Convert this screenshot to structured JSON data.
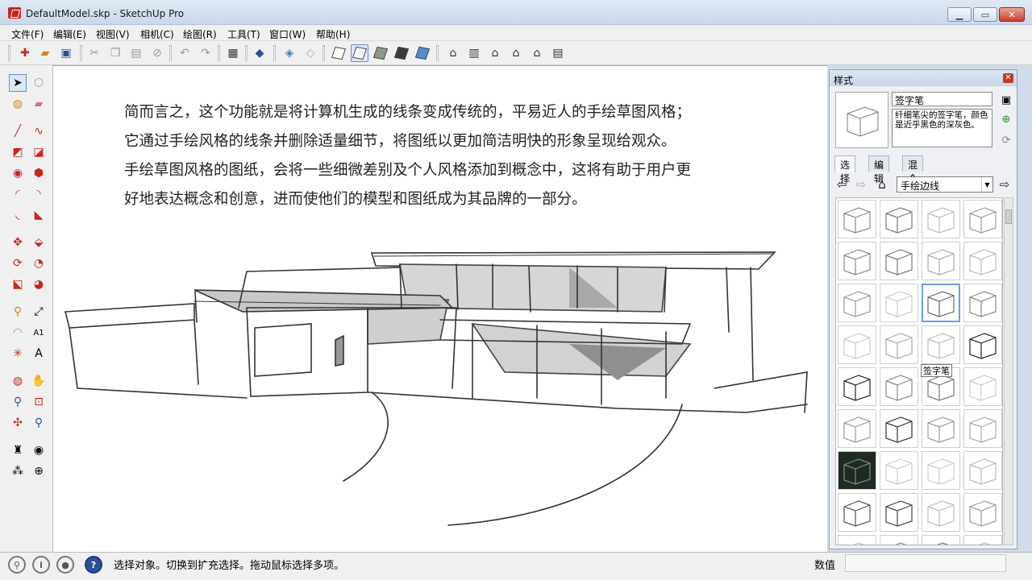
{
  "window": {
    "title": "DefaultModel.skp - SketchUp Pro",
    "minimize": "▁",
    "maximize": "▭",
    "close": "✕"
  },
  "menu": [
    "文件(F)",
    "编辑(E)",
    "视图(V)",
    "相机(C)",
    "绘图(R)",
    "工具(T)",
    "窗口(W)",
    "帮助(H)"
  ],
  "canvas": {
    "paragraph": [
      "简而言之，这个功能就是将计算机生成的线条变成传统的，平易近人的手绘草图风格；",
      "它通过手绘风格的线条并删除适量细节，将图纸以更加简洁明快的形象呈现给观众。",
      "手绘草图风格的图纸，会将一些细微差别及个人风格添加到概念中，这将有助于用户更",
      "好地表达概念和创意，进而使他们的模型和图纸成为其品牌的一部分。"
    ]
  },
  "styles_panel": {
    "title": "样式",
    "close": "✕",
    "style_name": "签字笔",
    "style_description": "纤细笔尖的签字笔，颜色是近乎黑色的深灰色。",
    "tabs": [
      "选择",
      "编辑",
      "混合"
    ],
    "active_tab": "选择",
    "collection_select": "手绘边线",
    "tooltip": "签字笔",
    "selected_thumb_index": 10,
    "dark_thumb_index": 24
  },
  "statusbar": {
    "message": "选择对象。切换到扩充选择。拖动鼠标选择多项。",
    "measurements_label": "数值",
    "measurements_value": ""
  },
  "colors": {
    "accent": "#6b9ee0",
    "close_red": "#c6402a",
    "selection_blue": "#dbe7f7"
  }
}
